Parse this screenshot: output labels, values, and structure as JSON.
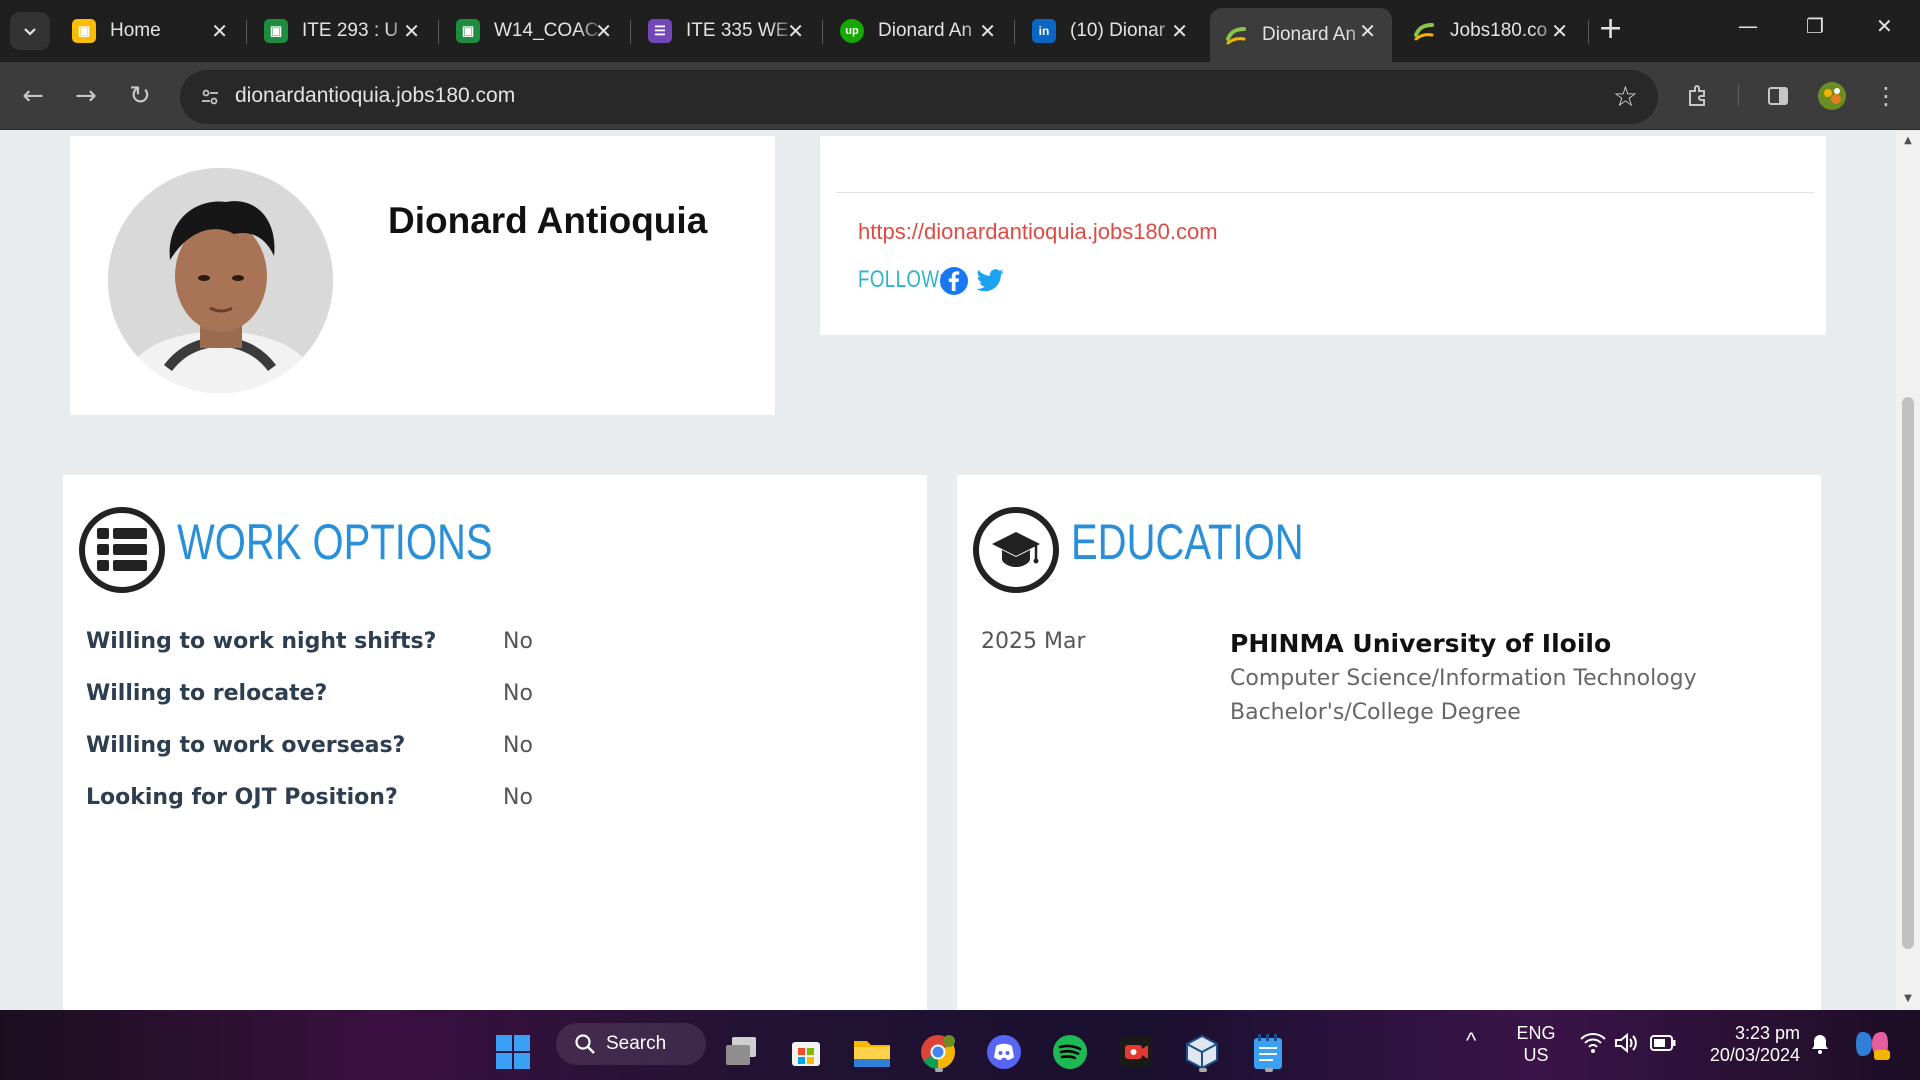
{
  "browser": {
    "tabs": [
      {
        "title": "Home",
        "icon": "google-classroom-icon",
        "color": "#fbbc04"
      },
      {
        "title": "ITE 293 : U",
        "icon": "google-classroom-icon",
        "color": "#1e8e3e"
      },
      {
        "title": "W14_COAC",
        "icon": "google-classroom-icon",
        "color": "#1e8e3e"
      },
      {
        "title": "ITE 335 WE",
        "icon": "google-forms-icon",
        "color": "#7248b9"
      },
      {
        "title": "Dionard An",
        "icon": "upwork-icon",
        "color": "#14a800"
      },
      {
        "title": "(10) Dionar",
        "icon": "linkedin-icon",
        "color": "#0a66c2"
      },
      {
        "title": "Dionard An",
        "icon": "jobs180-icon",
        "color": "#8bc34a"
      },
      {
        "title": "Jobs180.co",
        "icon": "jobs180-icon",
        "color": "#8bc34a"
      }
    ],
    "url": "dionardantioquia.jobs180.com"
  },
  "profile": {
    "name": "Dionard Antioquia",
    "website": "https://dionardantioquia.jobs180.com",
    "follow_label": "FOLLOW:"
  },
  "work_options": {
    "title": "WORK OPTIONS",
    "rows": [
      {
        "label": "Willing to work night shifts?",
        "value": "No"
      },
      {
        "label": "Willing to relocate?",
        "value": "No"
      },
      {
        "label": "Willing to work overseas?",
        "value": "No"
      },
      {
        "label": "Looking for OJT Position?",
        "value": "No"
      }
    ]
  },
  "education": {
    "title": "EDUCATION",
    "date": "2025 Mar",
    "school": "PHINMA University of Iloilo",
    "field": "Computer Science/Information Technology",
    "degree": "Bachelor's/College Degree"
  },
  "taskbar": {
    "search_label": "Search",
    "lang_top": "ENG",
    "lang_bottom": "US",
    "time": "3:23 pm",
    "date": "20/03/2024"
  }
}
